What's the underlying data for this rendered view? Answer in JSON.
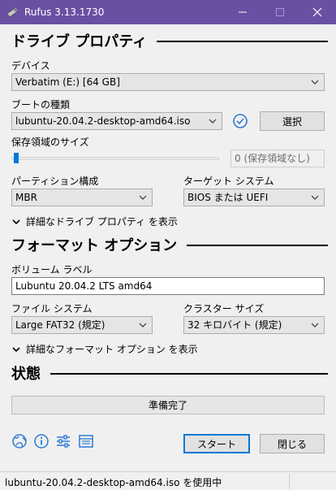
{
  "window": {
    "title": "Rufus 3.13.1730",
    "accent": "#6b4fa3"
  },
  "drive_properties": {
    "header": "ドライブ プロパティ",
    "device_label": "デバイス",
    "device_value": "Verbatim (E:) [64 GB]",
    "boot_type_label": "ブートの種類",
    "boot_type_value": "lubuntu-20.04.2-desktop-amd64.iso",
    "select_button": "選択",
    "persistent_label": "保存領域のサイズ",
    "persistent_value": "0 (保存領域なし)",
    "persistent_slider_fraction": 0,
    "partition_label": "パーティション構成",
    "partition_value": "MBR",
    "target_label": "ターゲット システム",
    "target_value": "BIOS または UEFI",
    "advanced_toggle": "詳細なドライブ プロパティ を表示"
  },
  "format_options": {
    "header": "フォーマット オプション",
    "volume_label_label": "ボリューム ラベル",
    "volume_label_value": "Lubuntu 20.04.2 LTS amd64",
    "filesystem_label": "ファイル システム",
    "filesystem_value": "Large FAT32 (規定)",
    "cluster_label": "クラスター サイズ",
    "cluster_value": "32 キロバイト (規定)",
    "advanced_toggle": "詳細なフォーマット オプション を表示"
  },
  "status": {
    "header": "状態",
    "progress_text": "準備完了",
    "start_button": "スタート",
    "close_button": "閉じる"
  },
  "footer": {
    "message": "lubuntu-20.04.2-desktop-amd64.iso を使用中"
  },
  "icons": [
    "globe-icon",
    "info-icon",
    "settings-sliders-icon",
    "log-icon",
    "check-circle-icon"
  ]
}
